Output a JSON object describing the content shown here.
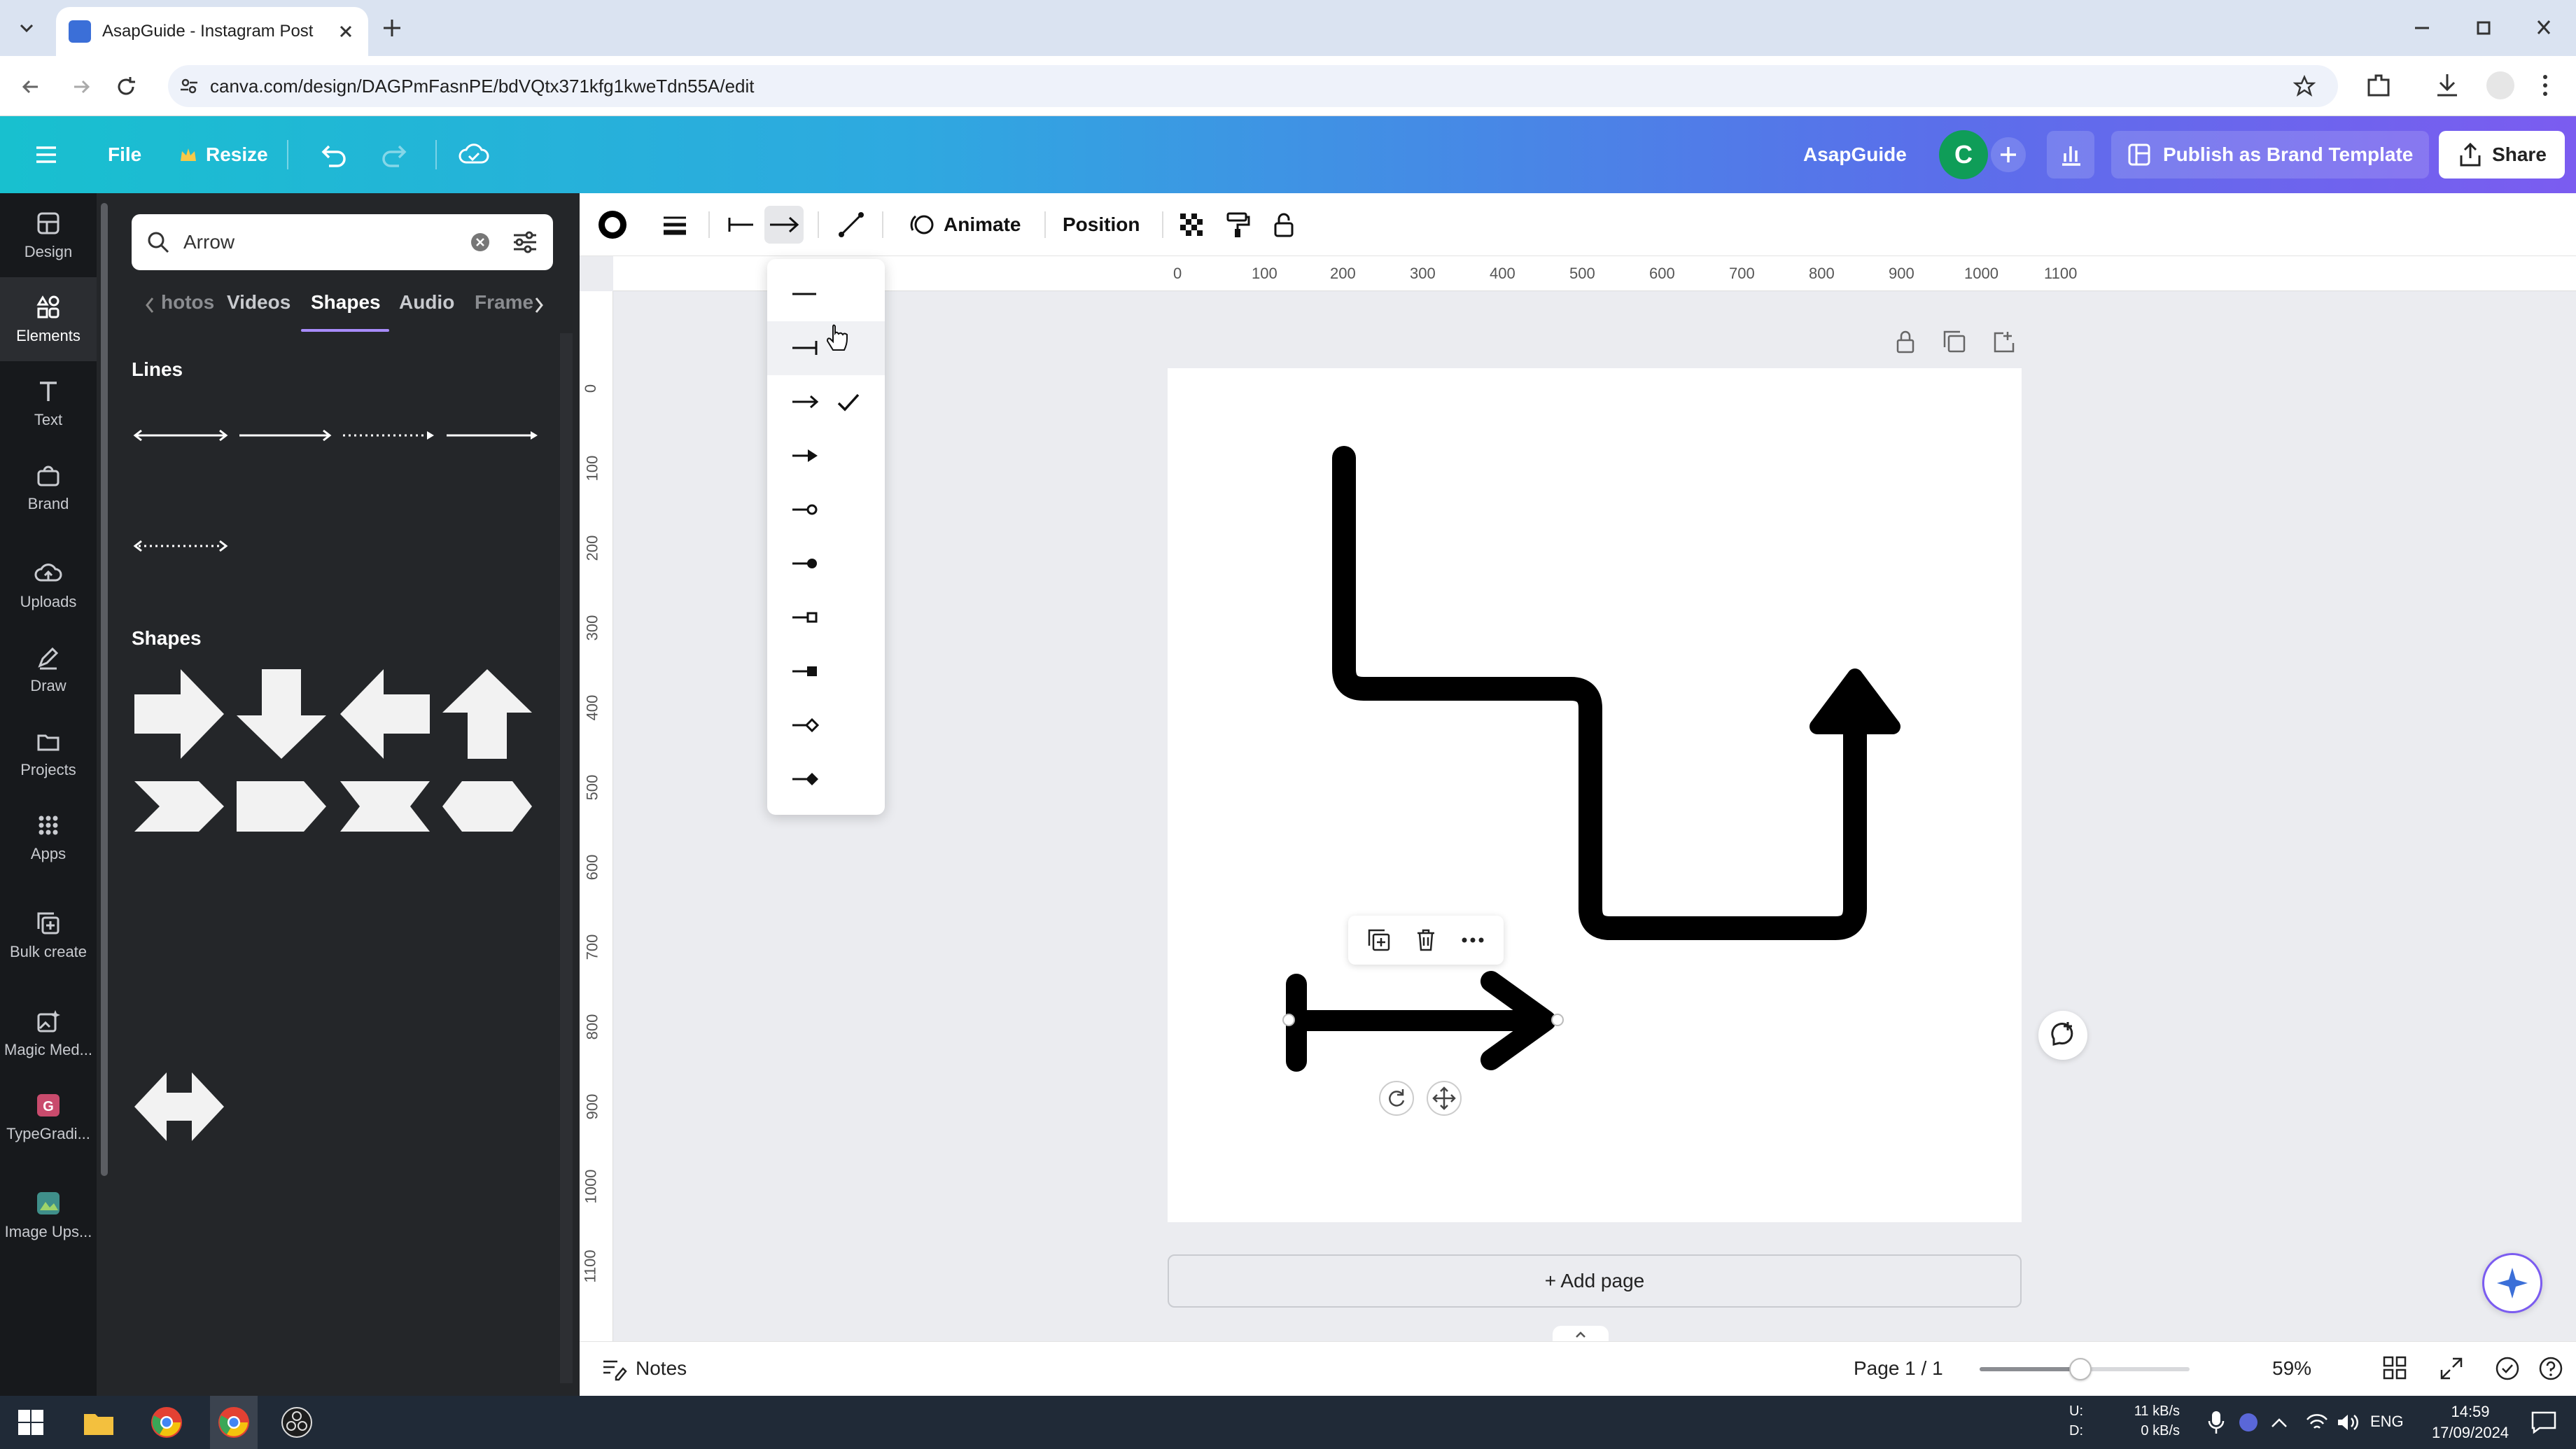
{
  "browser": {
    "tab_title": "AsapGuide - Instagram Post",
    "url": "canva.com/design/DAGPmFasnPE/bdVQtx371kfg1kweTdn55A/edit"
  },
  "header": {
    "file": "File",
    "resize": "Resize",
    "brand_name": "AsapGuide",
    "avatar_letter": "C",
    "publish": "Publish as Brand Template",
    "share": "Share"
  },
  "rail": [
    {
      "label": "Design",
      "icon": "design-icon"
    },
    {
      "label": "Elements",
      "icon": "elements-icon"
    },
    {
      "label": "Text",
      "icon": "text-icon"
    },
    {
      "label": "Brand",
      "icon": "brand-icon"
    },
    {
      "label": "Uploads",
      "icon": "uploads-icon"
    },
    {
      "label": "Draw",
      "icon": "draw-icon"
    },
    {
      "label": "Projects",
      "icon": "projects-icon"
    },
    {
      "label": "Apps",
      "icon": "apps-icon"
    },
    {
      "label": "Bulk create",
      "icon": "bulk-create-icon"
    },
    {
      "label": "Magic Med...",
      "icon": "magic-media-icon"
    },
    {
      "label": "TypeGradi...",
      "icon": "typegradient-icon"
    },
    {
      "label": "Image Ups...",
      "icon": "image-upscaler-icon"
    }
  ],
  "panel": {
    "search_value": "Arrow",
    "tabs": [
      "hotos",
      "Videos",
      "Shapes",
      "Audio",
      "Frame"
    ],
    "active_tab": "Shapes",
    "lines_heading": "Lines",
    "shapes_heading": "Shapes"
  },
  "toolbar": {
    "animate": "Animate",
    "position": "Position"
  },
  "ruler": {
    "h": [
      "0",
      "100",
      "200",
      "300",
      "400",
      "500",
      "600",
      "700",
      "800",
      "900",
      "1000",
      "1100"
    ],
    "v": [
      "0",
      "100",
      "200",
      "300",
      "400",
      "500",
      "600",
      "700",
      "800",
      "900",
      "1000",
      "1100"
    ]
  },
  "dropdown": {
    "options": [
      "none",
      "bar",
      "arrow",
      "filled-arrow",
      "circle",
      "filled-circle",
      "square",
      "filled-square",
      "diamond",
      "filled-diamond"
    ],
    "selected": "arrow"
  },
  "canvas": {
    "add_page": "+ Add page"
  },
  "footer": {
    "notes": "Notes",
    "page": "Page 1 / 1",
    "zoom": "59%",
    "zoom_fraction": 0.48
  },
  "taskbar": {
    "net_up_label": "U:",
    "net_down_label": "D:",
    "net_up": "11 kB/s",
    "net_down": "0 kB/s",
    "lang": "ENG",
    "time": "14:59",
    "date": "17/09/2024"
  },
  "colors": {
    "header_gradient_start": "#18c0cf",
    "header_gradient_end": "#7b5cf0",
    "panel_bg": "#242629",
    "rail_bg": "#17191c",
    "active_tab_underline": "#a78bfa"
  }
}
